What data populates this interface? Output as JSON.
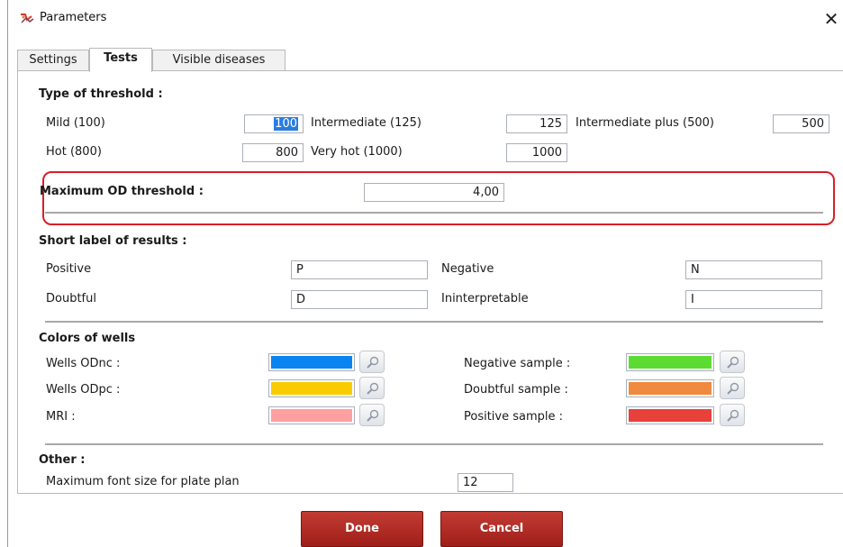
{
  "window": {
    "title": "Parameters",
    "close_glyph": "✕"
  },
  "tabs": [
    {
      "label": "Settings",
      "active": false
    },
    {
      "label": "Tests",
      "active": true
    },
    {
      "label": "Visible diseases",
      "active": false
    }
  ],
  "threshold": {
    "heading": "Type of threshold :",
    "mild_label": "Mild (100)",
    "mild_value": "100",
    "intermediate_label": "Intermediate (125)",
    "intermediate_value": "125",
    "intermediate_plus_label": "Intermediate plus (500)",
    "intermediate_plus_value": "500",
    "hot_label": "Hot (800)",
    "hot_value": "800",
    "very_hot_label": "Very hot (1000)",
    "very_hot_value": "1000"
  },
  "max_od": {
    "label": "Maximum OD threshold :",
    "value": "4,00"
  },
  "short_labels": {
    "heading": "Short label of results :",
    "positive_label": "Positive",
    "positive_value": "P",
    "negative_label": "Negative",
    "negative_value": "N",
    "doubtful_label": "Doubtful",
    "doubtful_value": "D",
    "ininterpretable_label": "Ininterpretable",
    "ininterpretable_value": "I"
  },
  "colors": {
    "heading": "Colors of wells",
    "wells_odnc_label": "Wells ODnc :",
    "wells_odnc_color": "#0a84f0",
    "wells_odpc_label": "Wells ODpc :",
    "wells_odpc_color": "#f8cc00",
    "mri_label": "MRI :",
    "mri_color": "#ff9fa0",
    "negative_sample_label": "Negative sample :",
    "negative_sample_color": "#5cdc32",
    "doubtful_sample_label": "Doubtful sample :",
    "doubtful_sample_color": "#f08a3e",
    "positive_sample_label": "Positive sample :",
    "positive_sample_color": "#e8403a"
  },
  "other": {
    "heading": "Other :",
    "font_size_label": "Maximum font size for plate plan",
    "font_size_value": "12"
  },
  "buttons": {
    "done": "Done",
    "cancel": "Cancel"
  },
  "icons": {
    "app": "parameters-app-icon",
    "picker": "magnifier-icon",
    "close": "close-icon"
  },
  "accent_colors": {
    "highlight": "#d8202a",
    "button": "#b02a23",
    "selection": "#2a7ce0"
  }
}
